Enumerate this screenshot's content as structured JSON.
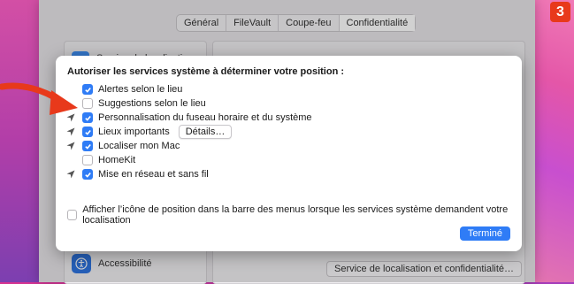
{
  "tabs": [
    {
      "label": "Général",
      "selected": false
    },
    {
      "label": "FileVault",
      "selected": false
    },
    {
      "label": "Coupe-feu",
      "selected": false
    },
    {
      "label": "Confidentialité",
      "selected": true
    }
  ],
  "sidebar": {
    "top_item": "Service de localisation",
    "bottom_item": "Accessibilité"
  },
  "footer_button": "Service de localisation et confidentialité…",
  "sheet": {
    "title": "Autoriser les services système à déterminer votre position :",
    "options": [
      {
        "label": "Alertes selon le lieu",
        "checked": true,
        "arrow": false
      },
      {
        "label": "Suggestions selon le lieu",
        "checked": false,
        "arrow": false
      },
      {
        "label": "Personnalisation du fuseau horaire et du système",
        "checked": true,
        "arrow": true
      },
      {
        "label": "Lieux importants",
        "checked": true,
        "arrow": true,
        "button": "Détails…"
      },
      {
        "label": "Localiser mon Mac",
        "checked": true,
        "arrow": true
      },
      {
        "label": "HomeKit",
        "checked": false,
        "arrow": false
      },
      {
        "label": "Mise en réseau et sans fil",
        "checked": true,
        "arrow": true
      }
    ],
    "status_bar_option": {
      "label": "Afficher l’icône de position dans la barre des menus lorsque les services système demandent votre localisation",
      "checked": false
    },
    "done_button": "Terminé"
  },
  "step_badge": "3",
  "colors": {
    "accent": "#2f7cf6",
    "annotation": "#e8391b"
  }
}
